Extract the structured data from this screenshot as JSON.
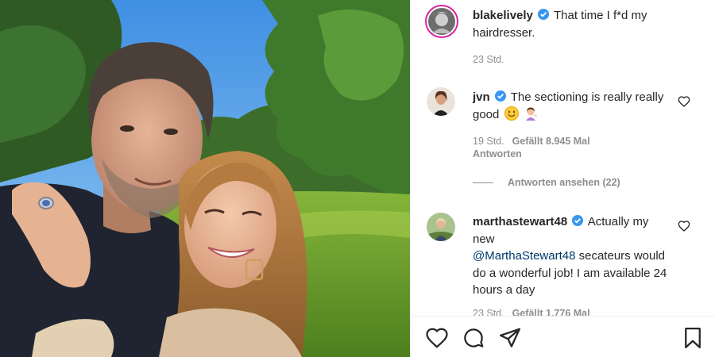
{
  "post": {
    "author": "blakelively",
    "caption": "That time I f*d my hairdresser.",
    "time": "23 Std."
  },
  "comments": [
    {
      "user": "jvn",
      "text": "The sectioning is really really good",
      "emoji": [
        "smiling-face-icon",
        "woman-tipping-hand-icon"
      ],
      "time": "19 Std.",
      "likes": "Gefällt 8.945 Mal",
      "reply_label": "Antworten",
      "view_replies": "Antworten ansehen (22)"
    },
    {
      "user": "marthastewart48",
      "text_before": "Actually my new ",
      "mention": "@MarthaStewart48",
      "text_after": " secateurs would do a wonderful job! I am available 24 hours a day",
      "time": "23 Std.",
      "likes": "Gefällt 1.776 Mal"
    }
  ],
  "actions": {
    "icons": [
      "heart-icon",
      "comment-icon",
      "share-icon",
      "bookmark-icon"
    ]
  },
  "colors": {
    "verified": "#3897f0",
    "text": "#262626",
    "muted": "#8e8e8e",
    "mention": "#00376b",
    "divider": "#efefef"
  }
}
